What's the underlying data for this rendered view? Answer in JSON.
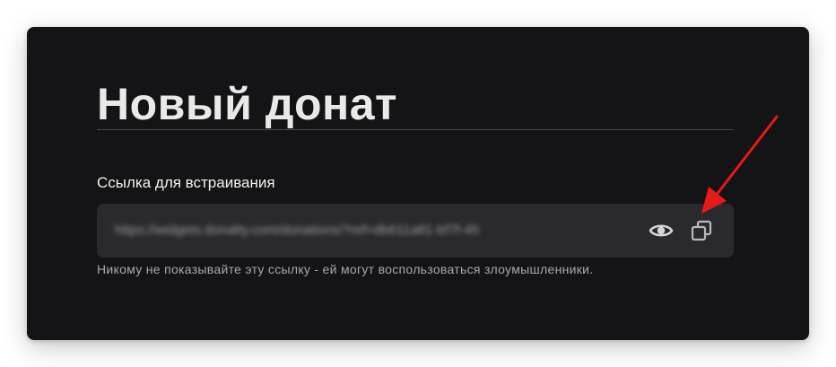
{
  "card": {
    "title": "Новый донат",
    "embed_link": {
      "label": "Ссылка для встраивания",
      "value": "https://widgets.donatty.com/donations/?ref=db611a81-bf7f-45",
      "hint": "Никому не показывайте эту ссылку - ей могут воспользоваться злоумышленники."
    }
  },
  "colors": {
    "card_background": "#141416",
    "field_background": "#2a2a2e",
    "annotation_arrow": "#e51b1b"
  },
  "icons": {
    "show": "eye-icon",
    "copy": "copy-icon"
  }
}
